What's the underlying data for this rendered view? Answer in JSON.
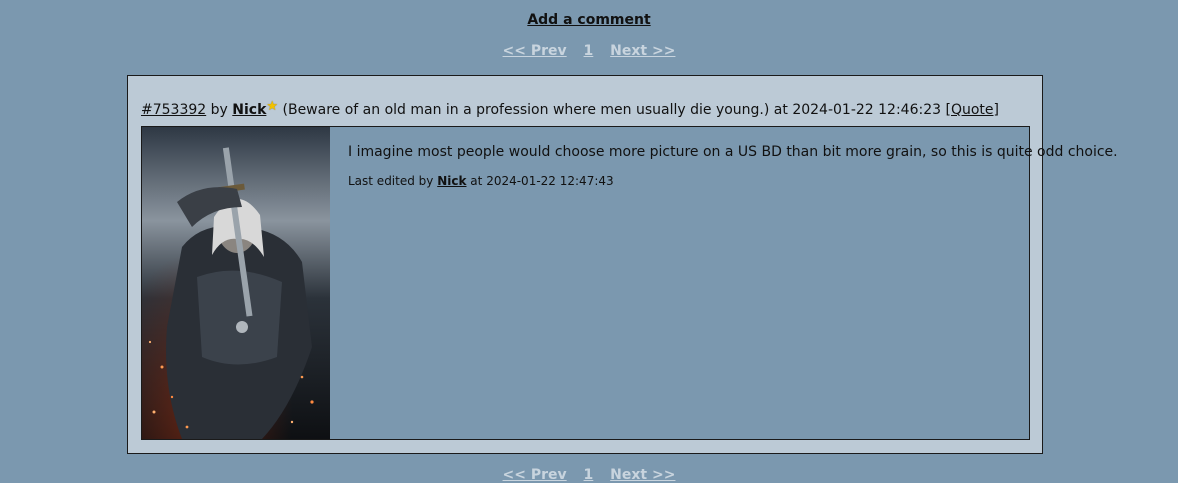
{
  "add_comment_label": "Add a comment",
  "pager": {
    "prev_label": "<< Prev",
    "page": "1",
    "next_label": "Next >>"
  },
  "comment": {
    "id_label": "#753392",
    "by_word": "by",
    "author": "Nick",
    "signature": "(Beware of an old man in a profession where men usually die young.)",
    "at_word": "at",
    "timestamp": "2024-01-22 12:46:23",
    "quote_label": "[Quote]",
    "text": "I imagine most people would choose more picture on a US BD than bit more grain, so this is quite odd choice.",
    "edit": {
      "prefix": "Last edited by",
      "author": "Nick",
      "at_word": "at",
      "timestamp": "2024-01-22 12:47:43"
    }
  },
  "colors": {
    "page_background": "#7b98af",
    "comment_box_background": "#bccad6",
    "pager_text": "#c8d4de",
    "star": "#f2c200"
  },
  "icons": {
    "star": "star-icon"
  }
}
